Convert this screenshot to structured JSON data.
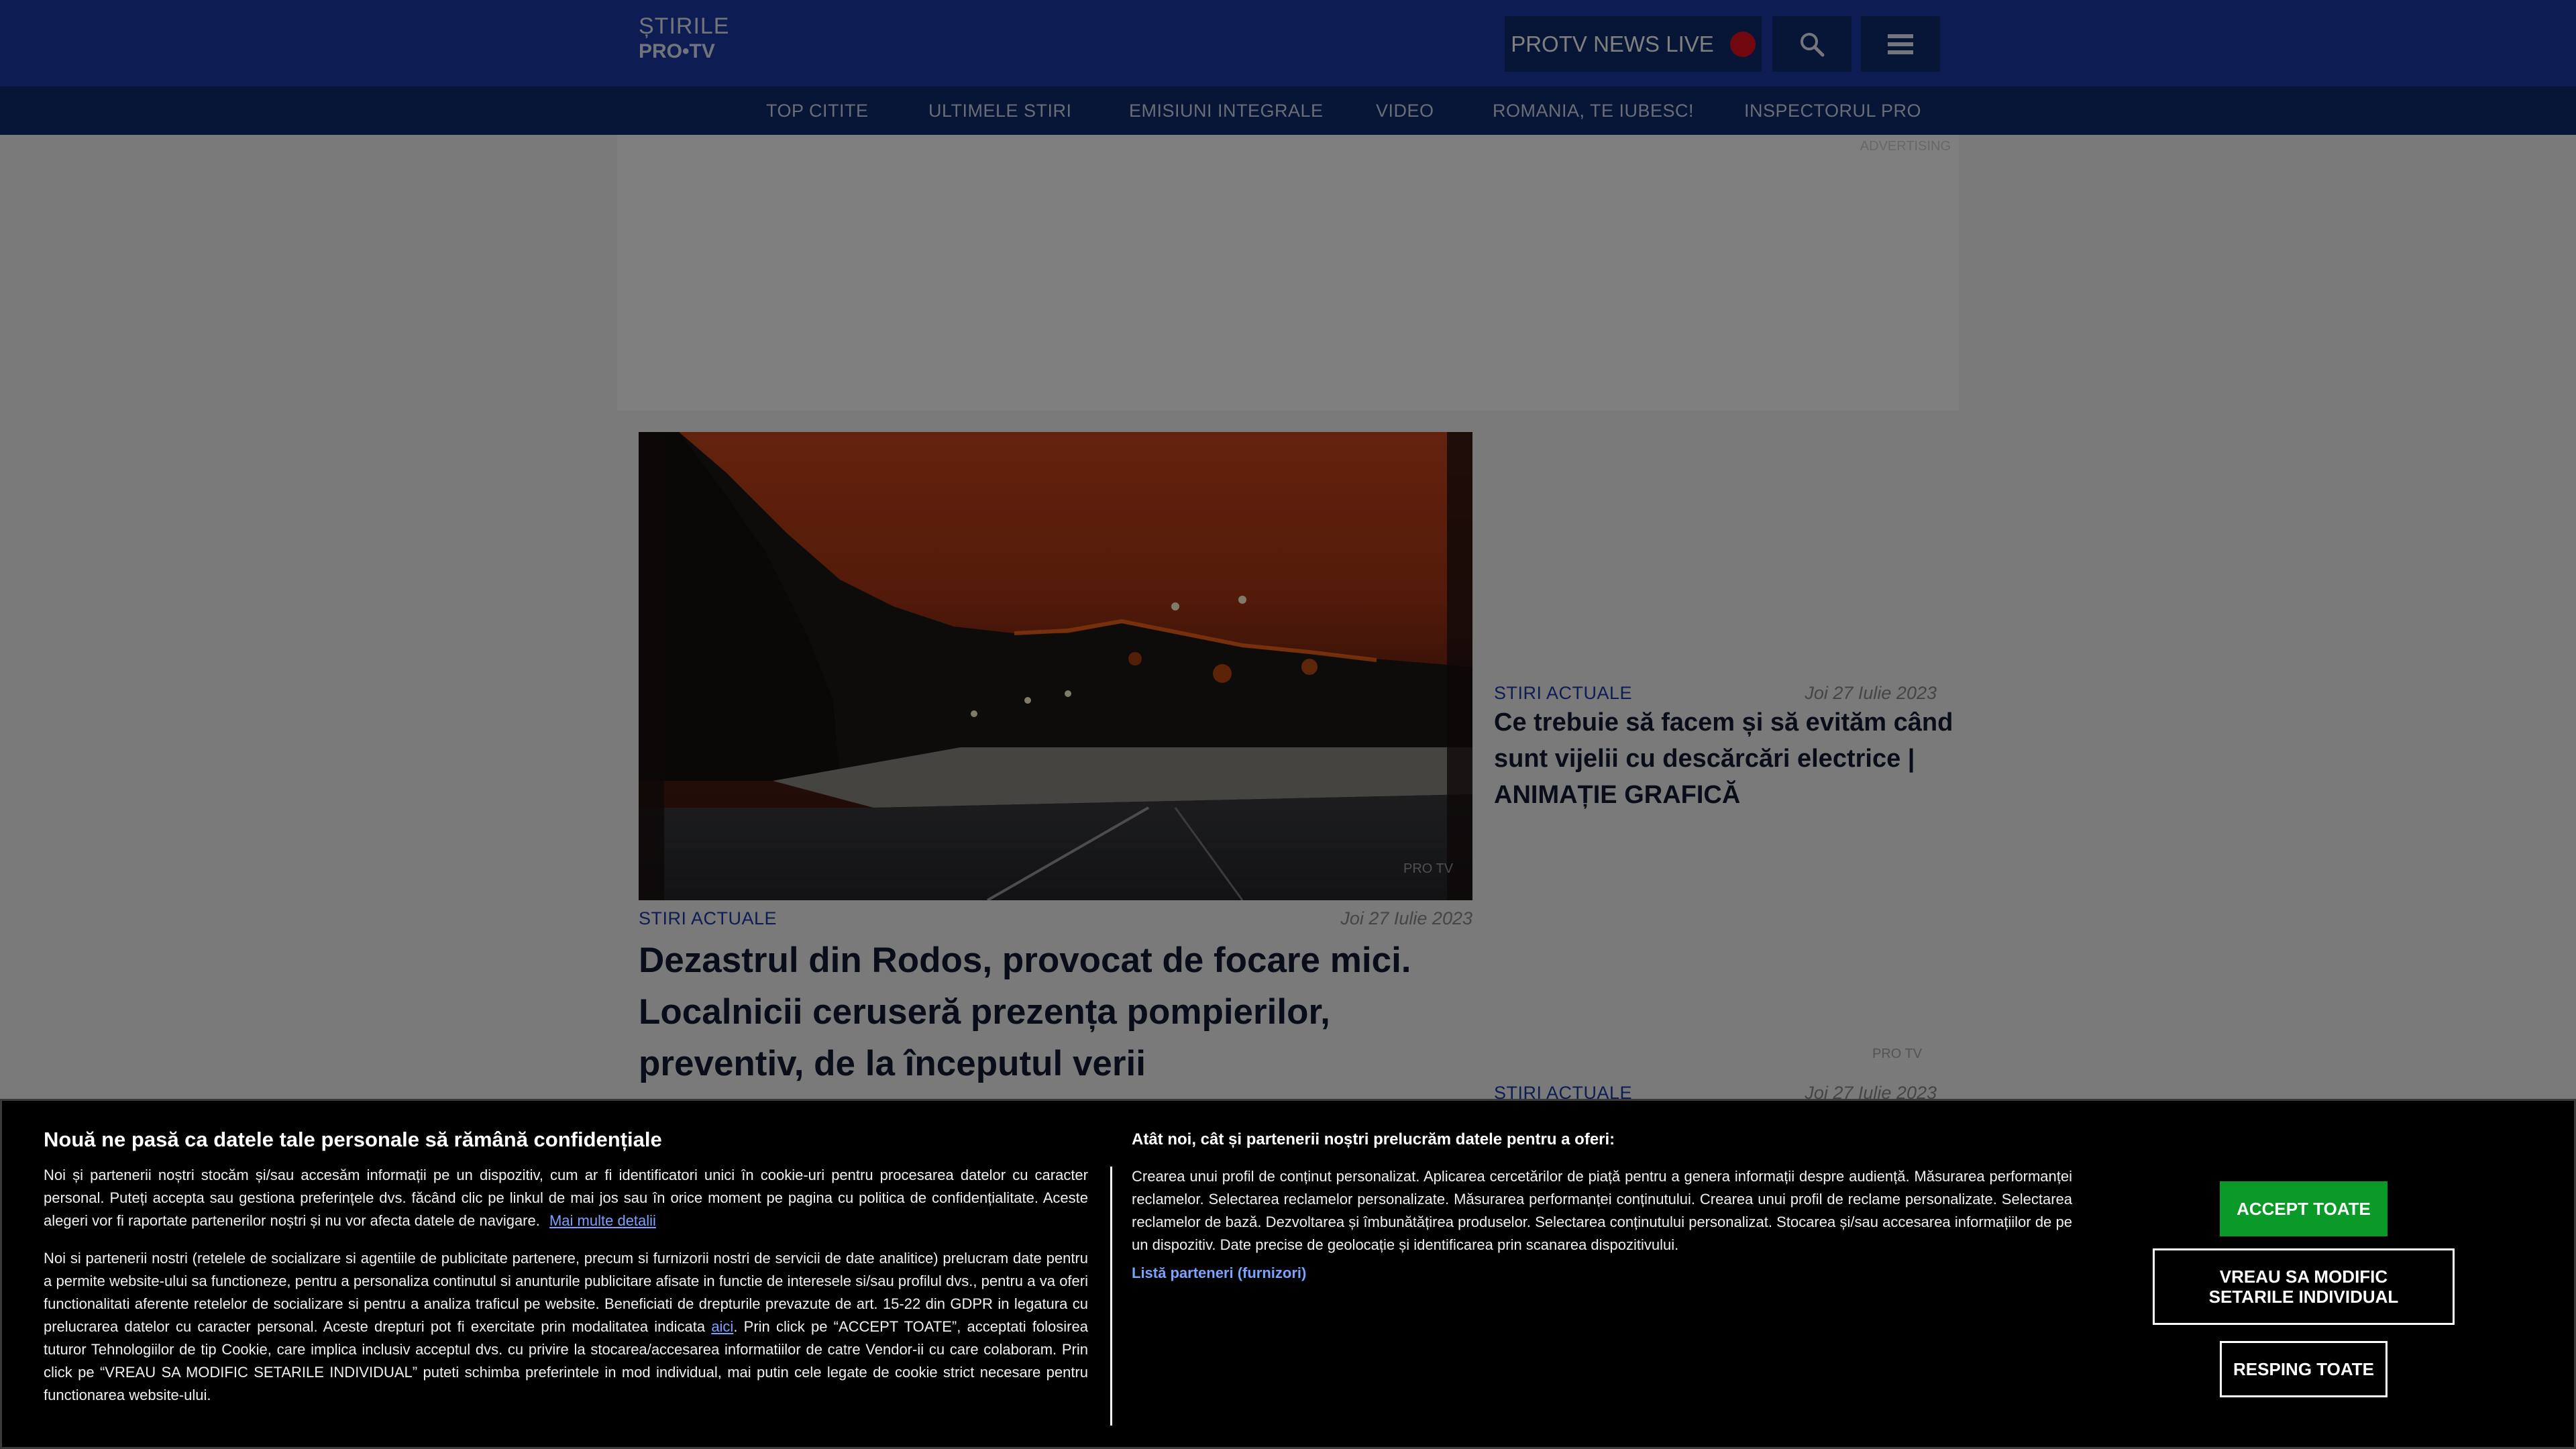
{
  "header": {
    "logo_line1": "ȘTIRILE",
    "logo_line2": "PRO•TV",
    "live_label": "PROTV NEWS LIVE",
    "search_icon": "search-icon",
    "menu_icon": "hamburger-menu-icon",
    "colors": {
      "bar": "#1b3aa6",
      "nav": "#0f2a6e",
      "live_dot": "#e3101e"
    }
  },
  "nav": {
    "items": [
      {
        "label": "TOP CITITE"
      },
      {
        "label": "ULTIMELE STIRI"
      },
      {
        "label": "EMISIUNI INTEGRALE"
      },
      {
        "label": "VIDEO"
      },
      {
        "label": "ROMANIA, TE IUBESC!"
      },
      {
        "label": "INSPECTORUL PRO"
      }
    ]
  },
  "ad": {
    "label": "ADVERTISING"
  },
  "articles": {
    "main": {
      "watermark": "PRO TV",
      "category": "STIRI ACTUALE",
      "date": "Joi 27 Iulie 2023",
      "title": "Dezastrul din Rodos, provocat de focare mici. Localnicii ceruseră prezența pompierilor, preventiv, de la începutul verii"
    },
    "side1": {
      "category": "STIRI ACTUALE",
      "date": "Joi 27 Iulie 2023",
      "title": "Ce trebuie să facem și să evităm când sunt vijelii cu descărcări electrice | ANIMAȚIE GRAFICĂ"
    },
    "side2": {
      "watermark": "PRO TV",
      "category": "STIRI ACTUALE",
      "date": "Joi 27 Iulie 2023"
    }
  },
  "consent": {
    "heading": "Nouă ne pasă ca datele tale personale să rămână confidențiale",
    "para1": "Noi și partenerii noștri stocăm și/sau accesăm informații pe un dispozitiv, cum ar fi identificatori unici în cookie-uri pentru procesarea datelor cu caracter personal. Puteți accepta sau gestiona preferințele dvs. făcând clic pe linkul de mai jos sau în orice moment pe pagina cu politica de confidențialitate. Aceste alegeri vor fi raportate partenerilor noștri și nu vor afecta datele de navigare.",
    "more_link": "Mai multe detalii",
    "para2_a": "Noi si partenerii nostri (retelele de socializare si agentiile de publicitate partenere, precum si furnizorii nostri de servicii de date analitice) prelucram date pentru a permite website-ului sa functioneze, pentru a personaliza continutul si anunturile publicitare afisate in functie de interesele si/sau profilul dvs., pentru a va oferi functionalitati aferente retelelor de socializare si pentru a analiza traficul pe website. Beneficiati de drepturile prevazute de art. 15-22 din GDPR in legatura cu prelucrarea datelor cu caracter personal. Aceste drepturi pot fi exercitate prin modalitatea indicata",
    "here_link": "aici",
    "para2_b": ". Prin click pe “ACCEPT TOATE”, acceptati folosirea tuturor Tehnologiilor de tip Cookie, care implica inclusiv acceptul dvs. cu privire la stocarea/accesarea informatiilor de catre Vendor-ii cu care colaboram. Prin click pe “VREAU SA MODIFIC SETARILE INDIVIDUAL” puteti schimba preferintele in mod individual, mai putin cele legate de cookie strict necesare pentru functionarea website-ului.",
    "heading2": "Atât noi, cât și partenerii noștri prelucrăm datele pentru a oferi:",
    "purposes": "Crearea unui profil de conținut personalizat. Aplicarea cercetărilor de piață pentru a genera informații despre audiență. Măsurarea performanței reclamelor. Selectarea reclamelor personalizate. Măsurarea performanței conținutului. Crearea unui profil de reclame personalizate. Selectarea reclamelor de bază. Dezvoltarea și îmbunătățirea produselor. Selectarea conținutului personalizat. Stocarea și/sau accesarea informațiilor de pe un dispozitiv. Date precise de geolocație și identificarea prin scanarea dispozitivului.",
    "partners_link": "Listă parteneri (furnizori)",
    "accept_all": "ACCEPT TOATE",
    "modify": "VREAU SA MODIFIC SETARILE INDIVIDUAL",
    "reject_all": "RESPING TOATE",
    "colors": {
      "accept": "#0a9a28",
      "link": "#7aa3ff"
    }
  }
}
